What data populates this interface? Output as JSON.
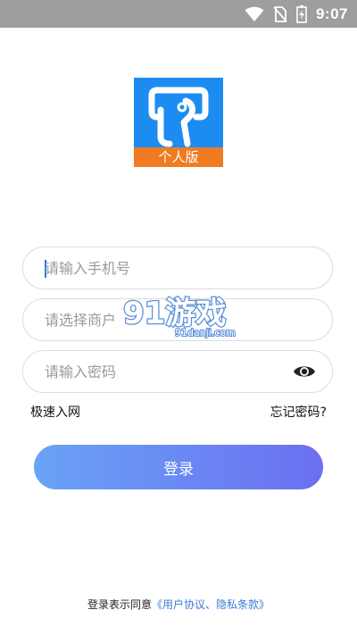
{
  "status_bar": {
    "time": "9:07",
    "icons": [
      "wifi-icon",
      "no-sim-icon",
      "battery-charging-icon"
    ],
    "background": "#9e9e9e"
  },
  "logo": {
    "badge_text": "个人版",
    "colors": {
      "primary": "#1c8cf0",
      "banner": "#f07b23"
    }
  },
  "form": {
    "phone_placeholder": "请输入手机号",
    "merchant_placeholder": "请选择商户",
    "password_placeholder": "请输入密码",
    "password_toggle_icon": "eye-icon"
  },
  "watermark": {
    "brand": "91游戏",
    "site": "91danji.com"
  },
  "links": {
    "quick_access": "极速入网",
    "forgot_password": "忘记密码?"
  },
  "login_button": {
    "label": "登录",
    "gradient": [
      "#6aa3f7",
      "#6b6ff0"
    ]
  },
  "agreement": {
    "prefix": "登录表示同意",
    "links": "《用户协议、隐私条款》",
    "link_color": "#3a7bd5"
  }
}
